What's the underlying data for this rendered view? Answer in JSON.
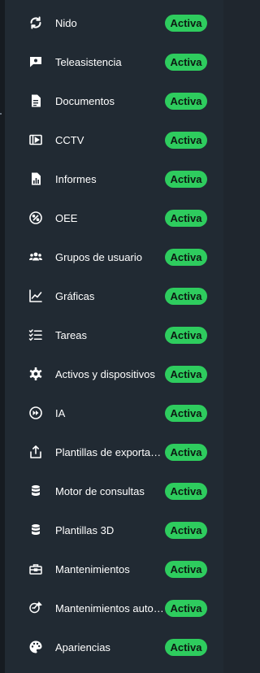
{
  "colors": {
    "background": "#212a33",
    "badge": "#2ecc5e",
    "text": "#ffffff"
  },
  "items": [
    {
      "icon": "sync-circle-icon",
      "label": "Nido",
      "status": "Activa"
    },
    {
      "icon": "chat-bubble-icon",
      "label": "Teleasistencia",
      "status": "Activa"
    },
    {
      "icon": "document-icon",
      "label": "Documentos",
      "status": "Activa"
    },
    {
      "icon": "video-camera-icon",
      "label": "CCTV",
      "status": "Activa"
    },
    {
      "icon": "report-chart-icon",
      "label": "Informes",
      "status": "Activa"
    },
    {
      "icon": "percent-circle-icon",
      "label": "OEE",
      "status": "Activa"
    },
    {
      "icon": "user-group-icon",
      "label": "Grupos de usuario",
      "status": "Activa"
    },
    {
      "icon": "line-chart-icon",
      "label": "Gráficas",
      "status": "Activa"
    },
    {
      "icon": "checklist-icon",
      "label": "Tareas",
      "status": "Activa"
    },
    {
      "icon": "gear-icon",
      "label": "Activos y dispositivos",
      "status": "Activa"
    },
    {
      "icon": "fast-forward-circle-icon",
      "label": "IA",
      "status": "Activa"
    },
    {
      "icon": "export-icon",
      "label": "Plantillas de exportación",
      "status": "Activa"
    },
    {
      "icon": "database-icon",
      "label": "Motor de consultas",
      "status": "Activa"
    },
    {
      "icon": "database-icon",
      "label": "Plantillas 3D",
      "status": "Activa"
    },
    {
      "icon": "toolbox-icon",
      "label": "Mantenimientos",
      "status": "Activa"
    },
    {
      "icon": "auto-maintenance-icon",
      "label": "Mantenimientos automáticos",
      "status": "Activa"
    },
    {
      "icon": "palette-icon",
      "label": "Apariencias",
      "status": "Activa"
    }
  ]
}
